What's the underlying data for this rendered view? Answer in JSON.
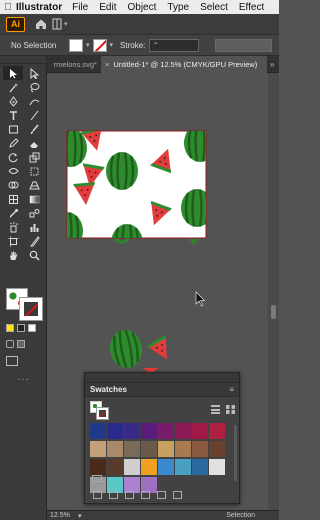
{
  "menubar": {
    "app_name": "Illustrator",
    "items": [
      "File",
      "Edit",
      "Object",
      "Type",
      "Select",
      "Effect"
    ]
  },
  "appbar": {
    "logo": "Ai"
  },
  "controlbar": {
    "selection_label": "No Selection",
    "stroke_label": "Stroke:",
    "stroke_caret": "⌃"
  },
  "tabs": {
    "inactive_label": "rmelons.svg*",
    "active_label": "Untitled-1* @ 12.5% (CMYK/GPU Preview)",
    "close_symbol": "×",
    "more_symbol": "»"
  },
  "swatches_panel": {
    "title": "Swatches",
    "menu_symbol": "≡",
    "colors_row1": [
      "#1f3a8a",
      "#2a2a8c",
      "#3a2a88",
      "#5a1e7a",
      "#7a1a6a",
      "#8c1a55",
      "#a01a45",
      "#b02040"
    ],
    "colors_row2": [
      "#c4a07a",
      "#a88a6a",
      "#7a6a5a",
      "#6a5a4a",
      "#c8a060",
      "#a87a50",
      "#8a5a40",
      "#6a4030"
    ],
    "colors_row3": [
      "#4a2a1a",
      "#5a3a2a",
      "#cfcfcf",
      "#f0a020",
      "#3a8ad0",
      "#4aa0c0",
      "#2a6aa0",
      "#e0e0e0"
    ],
    "colors_row4": [
      "#9a9a9a",
      "#5ac8c8",
      "#b080d0",
      "#a070c0"
    ]
  },
  "status": {
    "zoom": "12.5%",
    "mode": "Selection"
  },
  "colors": {
    "watermelon_green": "#2e8b2e",
    "watermelon_dark_stripe": "#1d5e1d",
    "watermelon_red": "#e23c3c",
    "artboard_border": "#8a1a1a"
  }
}
